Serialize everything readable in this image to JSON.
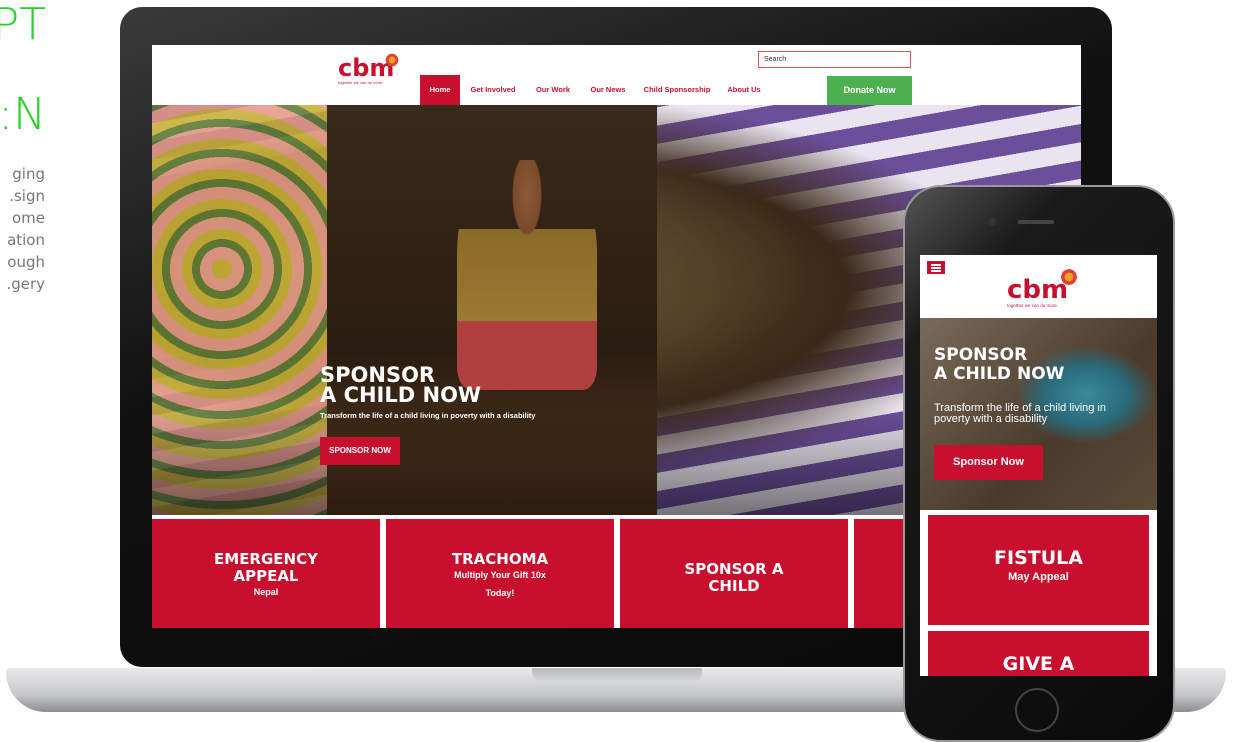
{
  "side_text": {
    "heading_lines": [
      "PT",
      "N:"
    ],
    "para_lines": [
      "ging",
      "sign.",
      "ome",
      "ation",
      "ough",
      "gery."
    ]
  },
  "site": {
    "logo_text": "cbm",
    "tagline": "together we can do more",
    "search_placeholder": "Search",
    "nav": [
      "Home",
      "Get Involved",
      "Our Work",
      "Our News",
      "Child Sponsorship",
      "About Us"
    ],
    "donate_label": "Donate Now",
    "hero": {
      "title_line1": "SPONSOR",
      "title_line2": "A CHILD NOW",
      "subtitle": "Transform the life of a child living in poverty with a disability",
      "button": "SPONSOR NOW"
    },
    "tiles": [
      {
        "title": "EMERGENCY APPEAL",
        "sub": "Nepal"
      },
      {
        "title": "TRACHOMA",
        "sub": "Multiply Your Gift 10x",
        "sub2": "Today!"
      },
      {
        "title": "SPONSOR A CHILD",
        "sub": ""
      }
    ]
  },
  "mobile": {
    "logo_text": "cbm",
    "tagline": "together we can do more",
    "hero_title_line1": "SPONSOR",
    "hero_title_line2": "A CHILD NOW",
    "hero_subtitle": "Transform the life of a child living in poverty with a disability",
    "hero_button": "Sponsor Now",
    "tile1_title": "FISTULA",
    "tile1_sub": "May Appeal",
    "tile2_title": "GIVE A"
  },
  "colors": {
    "brand_red": "#c8102e",
    "donate_green": "#4caf50",
    "heading_green": "#22d322"
  }
}
